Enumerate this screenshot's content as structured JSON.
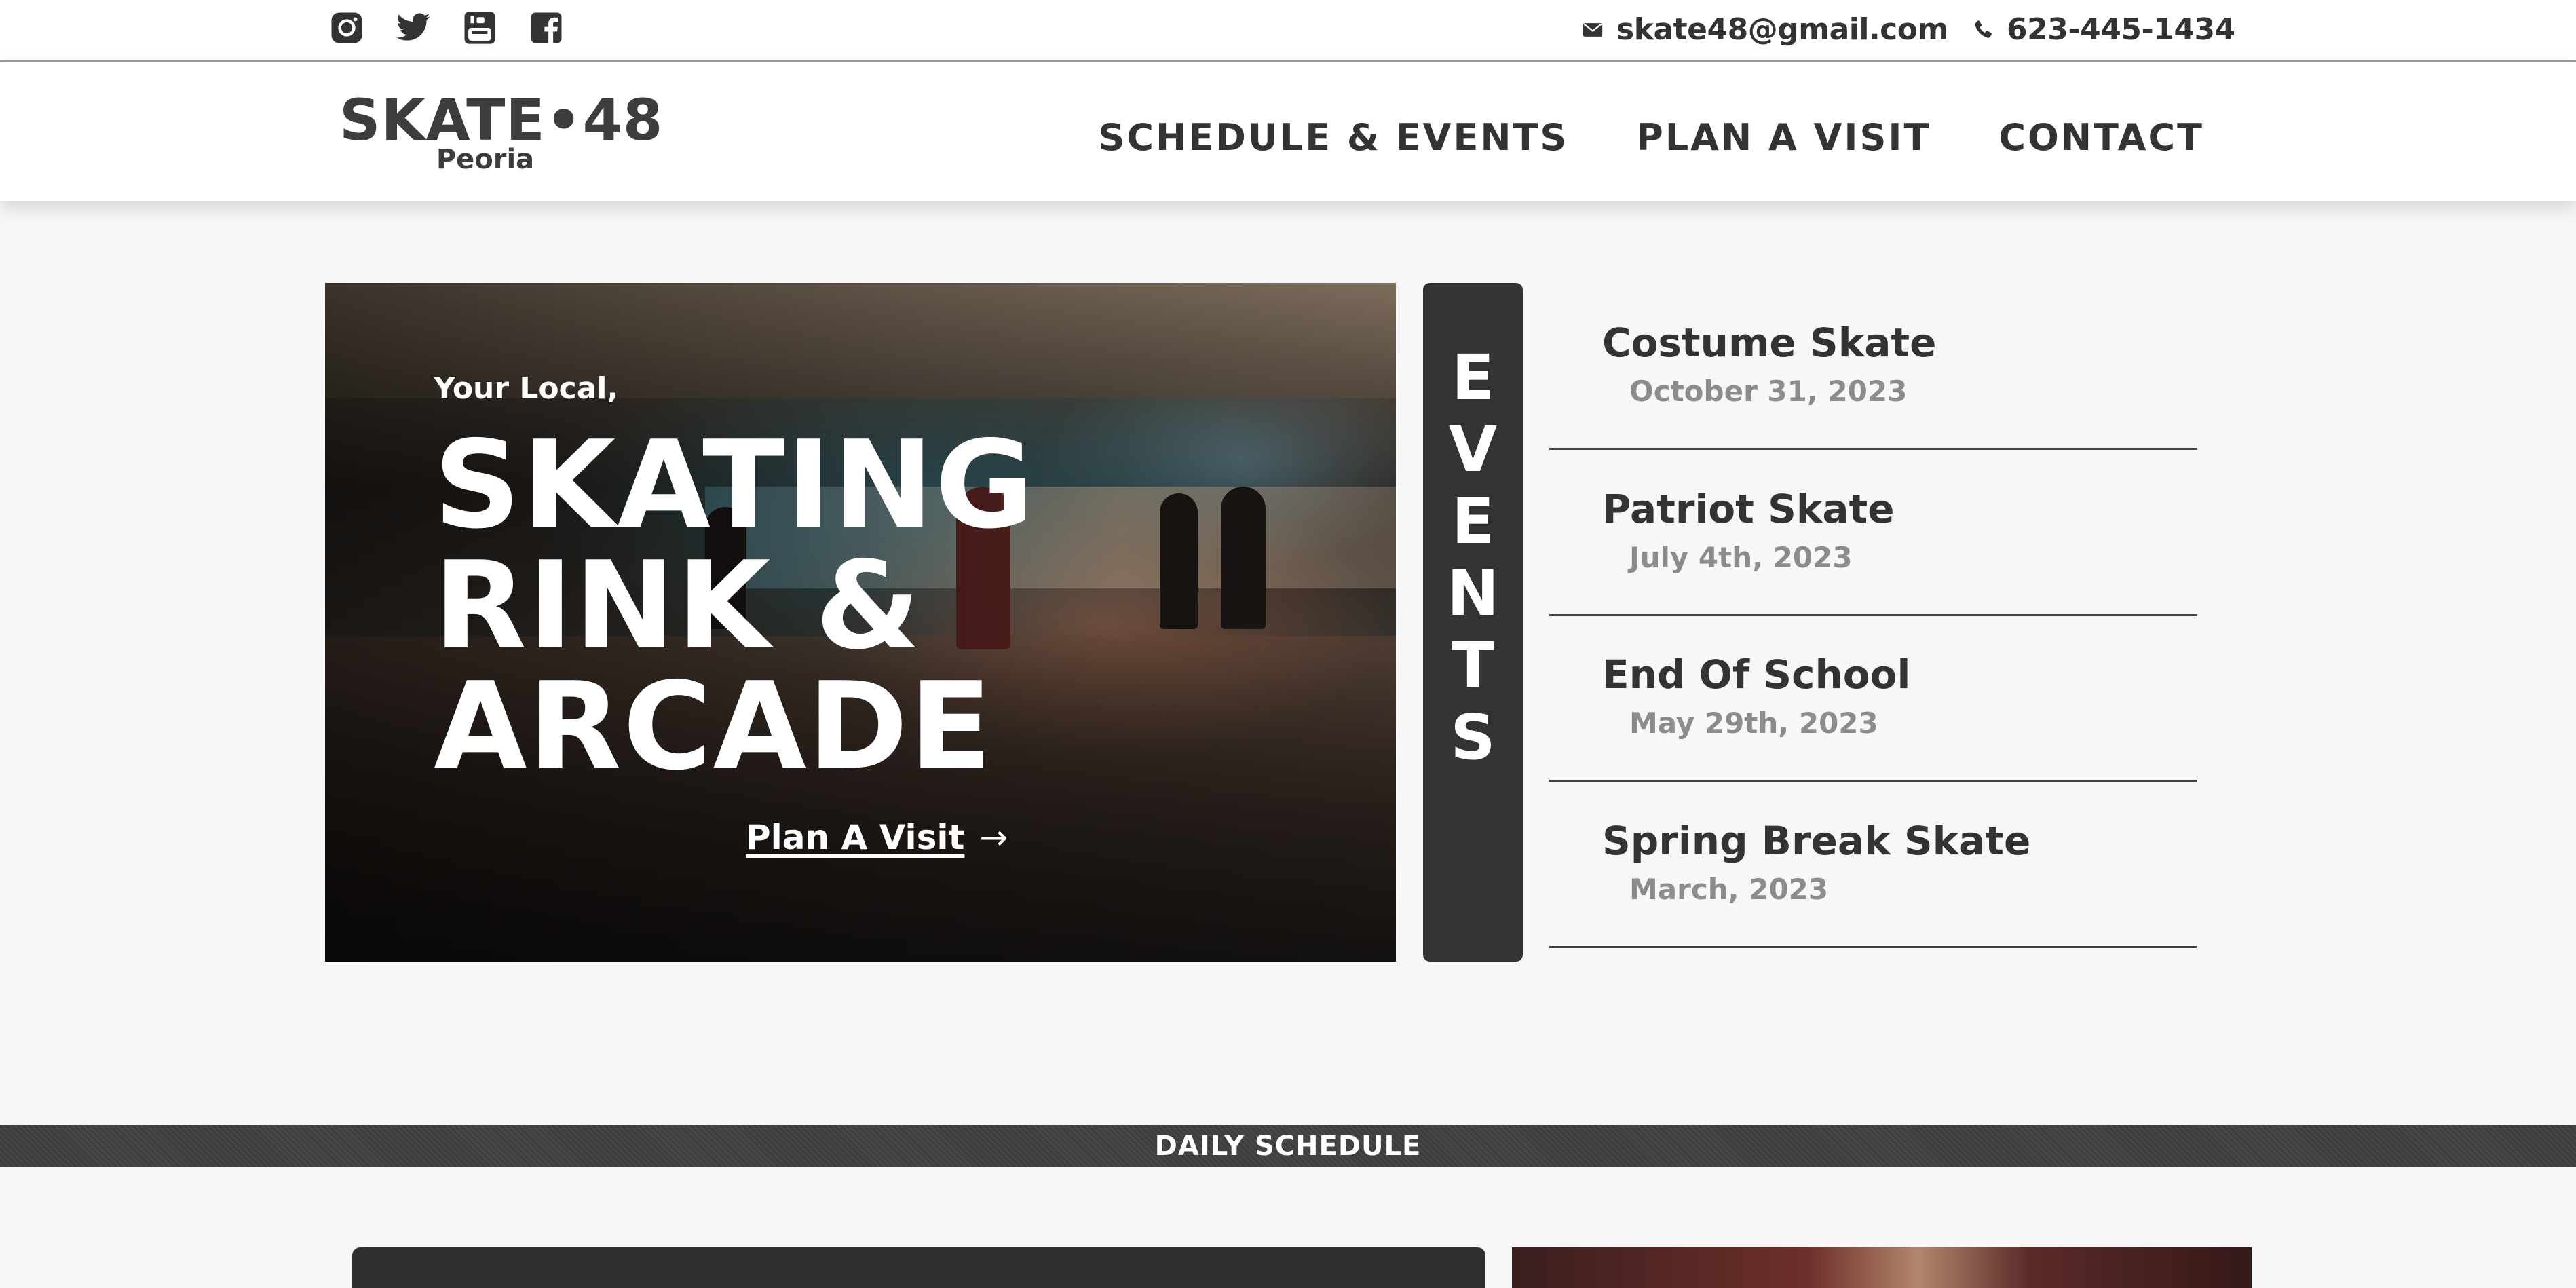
{
  "topbar": {
    "social": [
      {
        "name": "instagram-icon"
      },
      {
        "name": "twitter-icon"
      },
      {
        "name": "youtube-icon"
      },
      {
        "name": "facebook-icon"
      }
    ],
    "email": "skate48@gmail.com",
    "phone": "623-445-1434"
  },
  "header": {
    "logo_main": "SKATE•48",
    "logo_sub": "Peoria",
    "nav": [
      "SCHEDULE & EVENTS",
      "PLAN A VISIT",
      "CONTACT"
    ]
  },
  "hero": {
    "kicker": "Your Local,",
    "title_lines": [
      "SKATING",
      "RINK &",
      "ARCADE"
    ],
    "cta_label": "Plan A Visit",
    "cta_arrow": "→"
  },
  "events": {
    "tab_letters": [
      "E",
      "V",
      "E",
      "N",
      "T",
      "S"
    ],
    "items": [
      {
        "name": "Costume Skate",
        "date": "October 31, 2023"
      },
      {
        "name": "Patriot Skate",
        "date": "July 4th, 2023"
      },
      {
        "name": "End Of School",
        "date": "May 29th, 2023"
      },
      {
        "name": "Spring Break Skate",
        "date": "March, 2023"
      }
    ]
  },
  "schedule": {
    "band_title": "DAILY SCHEDULE"
  },
  "colors": {
    "dark": "#333333",
    "muted": "#8c8c8c",
    "white": "#ffffff"
  }
}
